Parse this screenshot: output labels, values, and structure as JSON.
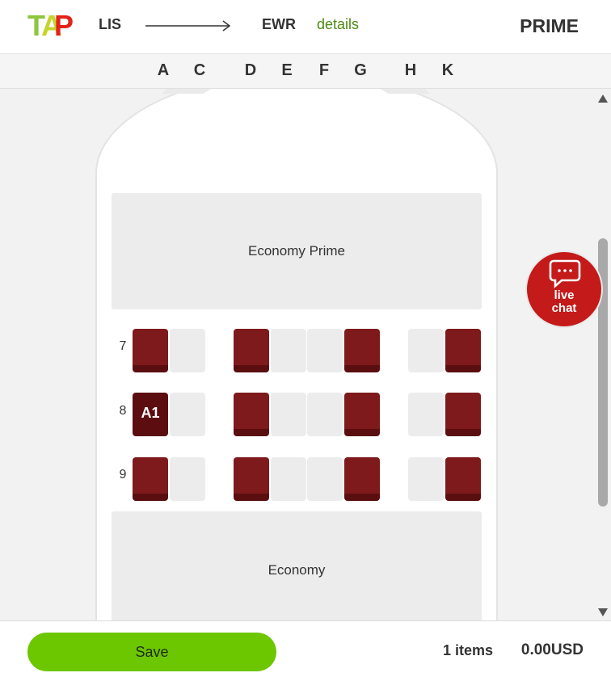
{
  "header": {
    "from": "LIS",
    "to": "EWR",
    "details_label": "details",
    "cabin": "PRIME",
    "brand_colors": {
      "green": "#8dc63f",
      "red": "#e2231a"
    }
  },
  "columns": [
    "A",
    "C",
    "D",
    "E",
    "F",
    "G",
    "H",
    "K"
  ],
  "zones": {
    "top_label": "Economy Prime",
    "bottom_label": "Economy"
  },
  "rows": [
    {
      "number": "7",
      "seats": [
        "taken",
        "empty",
        "taken",
        "empty",
        "empty",
        "taken",
        "empty",
        "taken"
      ]
    },
    {
      "number": "8",
      "seats": [
        "selected",
        "empty",
        "taken",
        "empty",
        "empty",
        "taken",
        "empty",
        "taken"
      ]
    },
    {
      "number": "9",
      "seats": [
        "taken",
        "empty",
        "taken",
        "empty",
        "empty",
        "taken",
        "empty",
        "taken"
      ]
    }
  ],
  "selected_seat_label": "A1",
  "live_chat": {
    "line1": "live",
    "line2": "chat",
    "icon": "chat-bubble-icon"
  },
  "footer": {
    "save_label": "Save",
    "items": "1 items",
    "total": "0.00USD"
  },
  "colors": {
    "seat_taken": "#7e1a1b",
    "seat_selected": "#5b0d10",
    "seat_empty": "#ececec",
    "save_button": "#6cc600",
    "live_chat": "#c41a1a",
    "details_link": "#4c8a12"
  }
}
